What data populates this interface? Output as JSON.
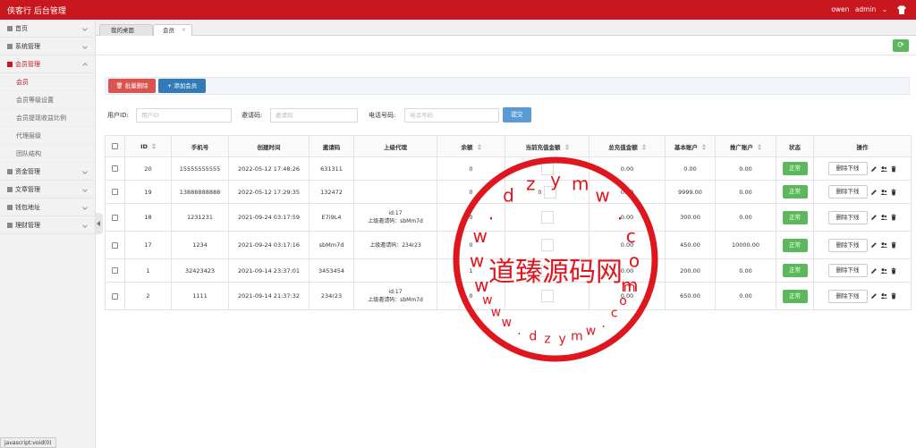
{
  "app": {
    "title": "侠客行 后台管理",
    "user_name": "owen",
    "user_role": "admin"
  },
  "sidebar": {
    "items": [
      {
        "label": "首页"
      },
      {
        "label": "系统管理"
      },
      {
        "label": "会员管理",
        "subitems": [
          "会员",
          "会员等级设置",
          "会员提现收益比例",
          "代理层级",
          "团队结构"
        ]
      },
      {
        "label": "资金管理"
      },
      {
        "label": "文章管理"
      },
      {
        "label": "钱包地址"
      },
      {
        "label": "理财管理"
      }
    ]
  },
  "status_bar": "javascript:void(0)",
  "tabs": [
    {
      "label": "我的桌面"
    },
    {
      "label": "会员",
      "close": "×"
    }
  ],
  "toolbar": {
    "batch_delete": "批量删除",
    "add_member": "添加会员"
  },
  "search": {
    "user_id_label": "用户ID:",
    "user_id_placeholder": "用户ID",
    "invite_label": "邀请码:",
    "invite_placeholder": "邀请码",
    "phone_label": "电话号码:",
    "phone_placeholder": "电话号码",
    "submit": "提交"
  },
  "table": {
    "columns": [
      "ID",
      "手机号",
      "创建时间",
      "邀请码",
      "上级代理",
      "余额",
      "当前充值金额",
      "总充值金额",
      "基本账户",
      "推广账户",
      "状态",
      "操作"
    ],
    "rows": [
      {
        "id": "20",
        "phone": "15555555555",
        "created": "2022-05-12 17:48:26",
        "invite": "631311",
        "parent": "",
        "parent_code": "",
        "balance": "0",
        "recharge": "",
        "total": "0.00",
        "basic": "0.00",
        "promo": "0.00",
        "status": "正常",
        "op": "删除下线"
      },
      {
        "id": "19",
        "phone": "13888888888",
        "created": "2022-05-12 17:29:35",
        "invite": "132472",
        "parent": "",
        "parent_code": "",
        "balance": "0",
        "recharge": "0",
        "total": "0.00",
        "basic": "9999.00",
        "promo": "0.00",
        "status": "正常",
        "op": "删除下线"
      },
      {
        "id": "18",
        "phone": "1231231",
        "created": "2021-09-24 03:17:59",
        "invite": "E7i9L4",
        "parent": "id:17",
        "parent_code": "上级邀请码：sbMm7d",
        "balance": "0",
        "recharge": "",
        "total": "0.00",
        "basic": "300.00",
        "promo": "0.00",
        "status": "正常",
        "op": "删除下线"
      },
      {
        "id": "17",
        "phone": "1234",
        "created": "2021-09-24 03:17:16",
        "invite": "sbMm7d",
        "parent": "",
        "parent_code": "上级邀请码：234r23",
        "balance": "0",
        "recharge": "",
        "total": "0.00",
        "basic": "450.00",
        "promo": "10000.00",
        "status": "正常",
        "op": "删除下线"
      },
      {
        "id": "1",
        "phone": "32423423",
        "created": "2021-09-14 23:37:01",
        "invite": "3453454",
        "parent": "",
        "parent_code": "",
        "balance": "1",
        "recharge": "",
        "total": "0.00",
        "basic": "200.00",
        "promo": "0.00",
        "status": "正常",
        "op": "删除下线"
      },
      {
        "id": "2",
        "phone": "1111",
        "created": "2021-09-14 21:37:32",
        "invite": "234r23",
        "parent": "id:17",
        "parent_code": "上级邀请码：sbMm7d",
        "balance": "0",
        "recharge": "",
        "total": "0.00",
        "basic": "650.00",
        "promo": "0.00",
        "status": "正常",
        "op": "删除下线"
      }
    ]
  },
  "watermark": {
    "center_text": "道臻源码网",
    "ring_top": [
      "w",
      "w",
      "w",
      ".",
      "d",
      "z",
      "y",
      "m",
      "w",
      ".",
      "c",
      "o",
      "m"
    ],
    "ring_bottom": [
      "w",
      "w",
      "w",
      ".",
      "d",
      "z",
      "y",
      "m",
      "w",
      ".",
      "c",
      "o",
      "m"
    ],
    "color": "#e0161e"
  },
  "colors": {
    "brand": "#c8171e",
    "success": "#5cb85c",
    "danger": "#d9534f",
    "primary": "#337ab7"
  }
}
